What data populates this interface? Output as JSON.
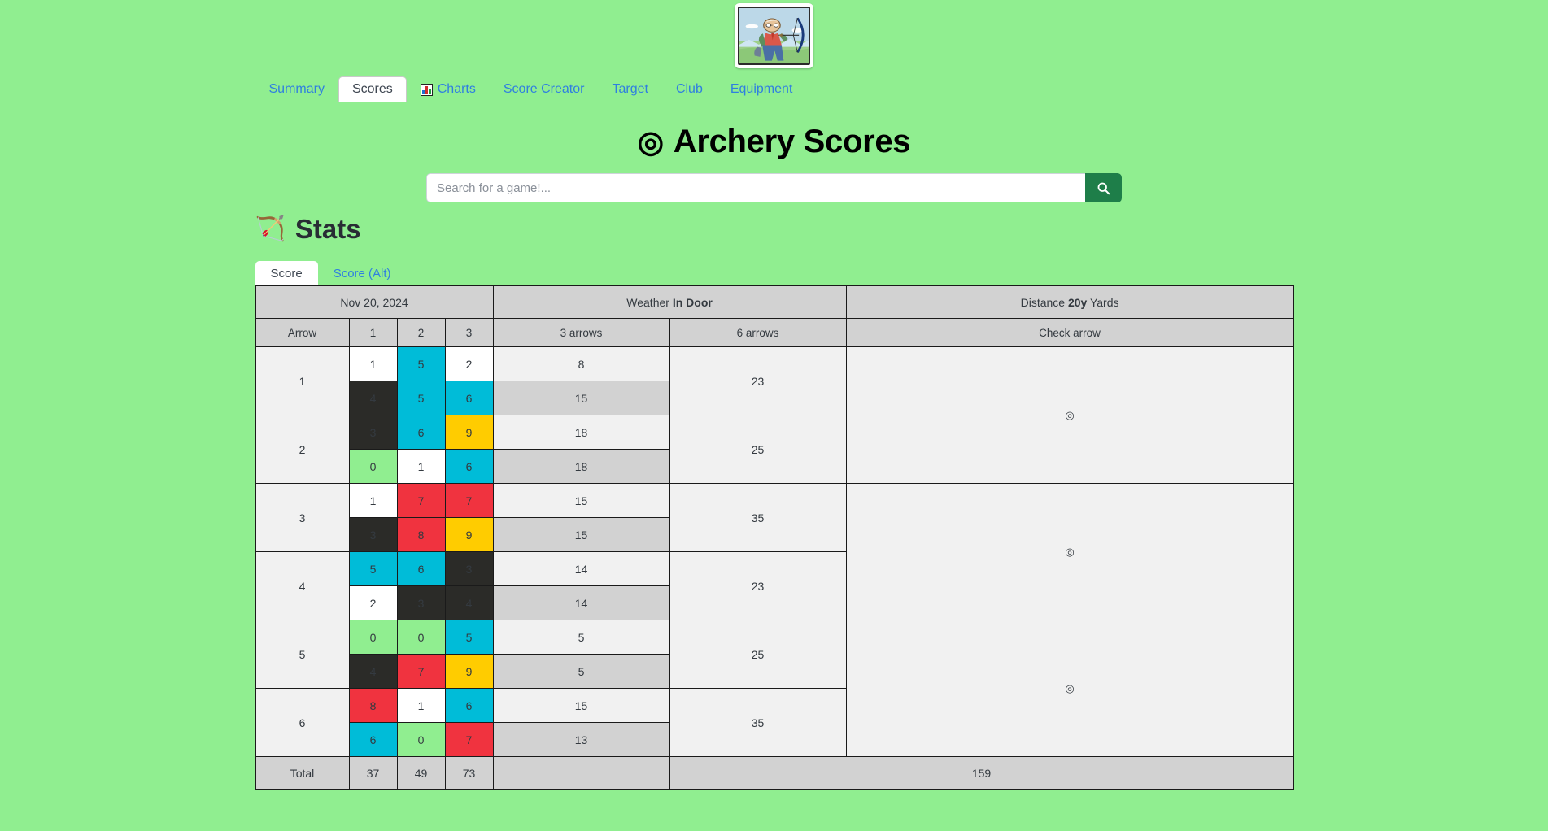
{
  "logo": {
    "alt": "archer-illustration"
  },
  "nav": {
    "items": [
      {
        "label": "Summary",
        "active": false,
        "icon": null
      },
      {
        "label": "Scores",
        "active": true,
        "icon": null
      },
      {
        "label": "Charts",
        "active": false,
        "icon": "bar-chart-icon"
      },
      {
        "label": "Score Creator",
        "active": false,
        "icon": null
      },
      {
        "label": "Target",
        "active": false,
        "icon": null
      },
      {
        "label": "Club",
        "active": false,
        "icon": null
      },
      {
        "label": "Equipment",
        "active": false,
        "icon": null
      }
    ]
  },
  "header": {
    "title": "Archery Scores",
    "title_icon": "◎"
  },
  "search": {
    "placeholder": "Search for a game!...",
    "value": "",
    "button_icon": "search-icon"
  },
  "stats": {
    "heading": "Stats",
    "icon": "🏹"
  },
  "subtabs": [
    {
      "label": "Score",
      "active": true
    },
    {
      "label": "Score (Alt)",
      "active": false
    }
  ],
  "table": {
    "meta": {
      "date": "Nov 20, 2024",
      "weather_label": "Weather",
      "weather_value": "In Door",
      "distance_label": "Distance",
      "distance_value": "20y",
      "distance_unit": "Yards"
    },
    "headers": [
      "Arrow",
      "1",
      "2",
      "3",
      "3 arrows",
      "6 arrows",
      "Check arrow"
    ],
    "check_icon": "◎",
    "rows": [
      {
        "index": "1",
        "six": "23",
        "lines": [
          {
            "scores": [
              {
                "v": "1",
                "c": "white"
              },
              {
                "v": "5",
                "c": "cyan"
              },
              {
                "v": "2",
                "c": "white"
              }
            ],
            "sum3": "8"
          },
          {
            "scores": [
              {
                "v": "4",
                "c": "black"
              },
              {
                "v": "5",
                "c": "cyan"
              },
              {
                "v": "6",
                "c": "cyan"
              }
            ],
            "sum3": "15"
          }
        ]
      },
      {
        "index": "2",
        "six": "25",
        "lines": [
          {
            "scores": [
              {
                "v": "3",
                "c": "black"
              },
              {
                "v": "6",
                "c": "cyan"
              },
              {
                "v": "9",
                "c": "yellow"
              }
            ],
            "sum3": "18"
          },
          {
            "scores": [
              {
                "v": "0",
                "c": "green"
              },
              {
                "v": "1",
                "c": "white"
              },
              {
                "v": "6",
                "c": "cyan"
              }
            ],
            "sum3": "18"
          }
        ]
      },
      {
        "index": "3",
        "six": "35",
        "lines": [
          {
            "scores": [
              {
                "v": "1",
                "c": "white"
              },
              {
                "v": "7",
                "c": "red"
              },
              {
                "v": "7",
                "c": "red"
              }
            ],
            "sum3": "15"
          },
          {
            "scores": [
              {
                "v": "3",
                "c": "black"
              },
              {
                "v": "8",
                "c": "red"
              },
              {
                "v": "9",
                "c": "yellow"
              }
            ],
            "sum3": "15"
          }
        ]
      },
      {
        "index": "4",
        "six": "23",
        "lines": [
          {
            "scores": [
              {
                "v": "5",
                "c": "cyan"
              },
              {
                "v": "6",
                "c": "cyan"
              },
              {
                "v": "3",
                "c": "black"
              }
            ],
            "sum3": "14"
          },
          {
            "scores": [
              {
                "v": "2",
                "c": "white"
              },
              {
                "v": "3",
                "c": "black"
              },
              {
                "v": "4",
                "c": "black"
              }
            ],
            "sum3": "14"
          }
        ]
      },
      {
        "index": "5",
        "six": "25",
        "lines": [
          {
            "scores": [
              {
                "v": "0",
                "c": "green"
              },
              {
                "v": "0",
                "c": "green"
              },
              {
                "v": "5",
                "c": "cyan"
              }
            ],
            "sum3": "5"
          },
          {
            "scores": [
              {
                "v": "4",
                "c": "black"
              },
              {
                "v": "7",
                "c": "red"
              },
              {
                "v": "9",
                "c": "yellow"
              }
            ],
            "sum3": "5"
          }
        ]
      },
      {
        "index": "6",
        "six": "35",
        "lines": [
          {
            "scores": [
              {
                "v": "8",
                "c": "red"
              },
              {
                "v": "1",
                "c": "white"
              },
              {
                "v": "6",
                "c": "cyan"
              }
            ],
            "sum3": "15"
          },
          {
            "scores": [
              {
                "v": "6",
                "c": "cyan"
              },
              {
                "v": "0",
                "c": "green"
              },
              {
                "v": "7",
                "c": "red"
              }
            ],
            "sum3": "13"
          }
        ]
      }
    ],
    "total": {
      "label": "Total",
      "columns": [
        "37",
        "49",
        "73"
      ],
      "blank": "",
      "grand": "159"
    }
  },
  "colors": {
    "page_bg": "#90ee90",
    "accent_link": "#2f7fe0",
    "search_button": "#1e7e49",
    "score_white": "#ffffff",
    "score_black": "#2b2b28",
    "score_cyan": "#00bcd8",
    "score_red": "#f0333f",
    "score_yellow": "#ffcc00",
    "score_green": "#90ee90"
  }
}
